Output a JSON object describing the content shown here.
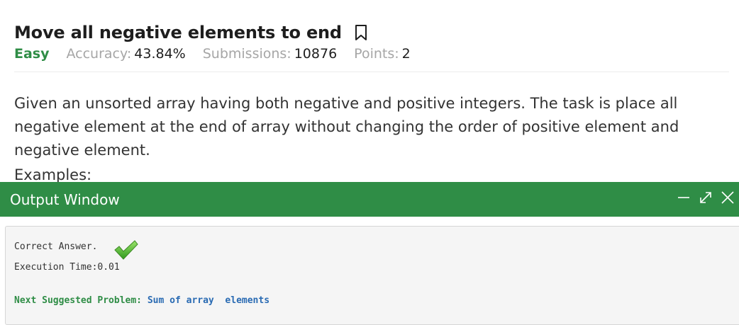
{
  "problem": {
    "title": "Move all negative elements to end",
    "difficulty": "Easy",
    "accuracy_label": "Accuracy:",
    "accuracy_value": "43.84%",
    "submissions_label": "Submissions:",
    "submissions_value": "10876",
    "points_label": "Points:",
    "points_value": "2",
    "description": "Given an unsorted array having both negative and positive integers. The task is place all negative element at the end of array without changing the order of positive element and negative element.",
    "examples_heading": "Examples:"
  },
  "output_window": {
    "title": "Output Window",
    "result_text": "Correct Answer.",
    "execution_time": "Execution Time:0.01",
    "next_label": "Next Suggested Problem:",
    "next_link": "Sum of array  elements"
  },
  "icons": [
    "bookmark-icon",
    "minimize-icon",
    "expand-icon",
    "close-icon",
    "checkmark-icon"
  ],
  "colors": {
    "accent_green": "#2f8d46",
    "link_blue": "#2a6bb3",
    "muted_gray": "#a6a6a6"
  }
}
